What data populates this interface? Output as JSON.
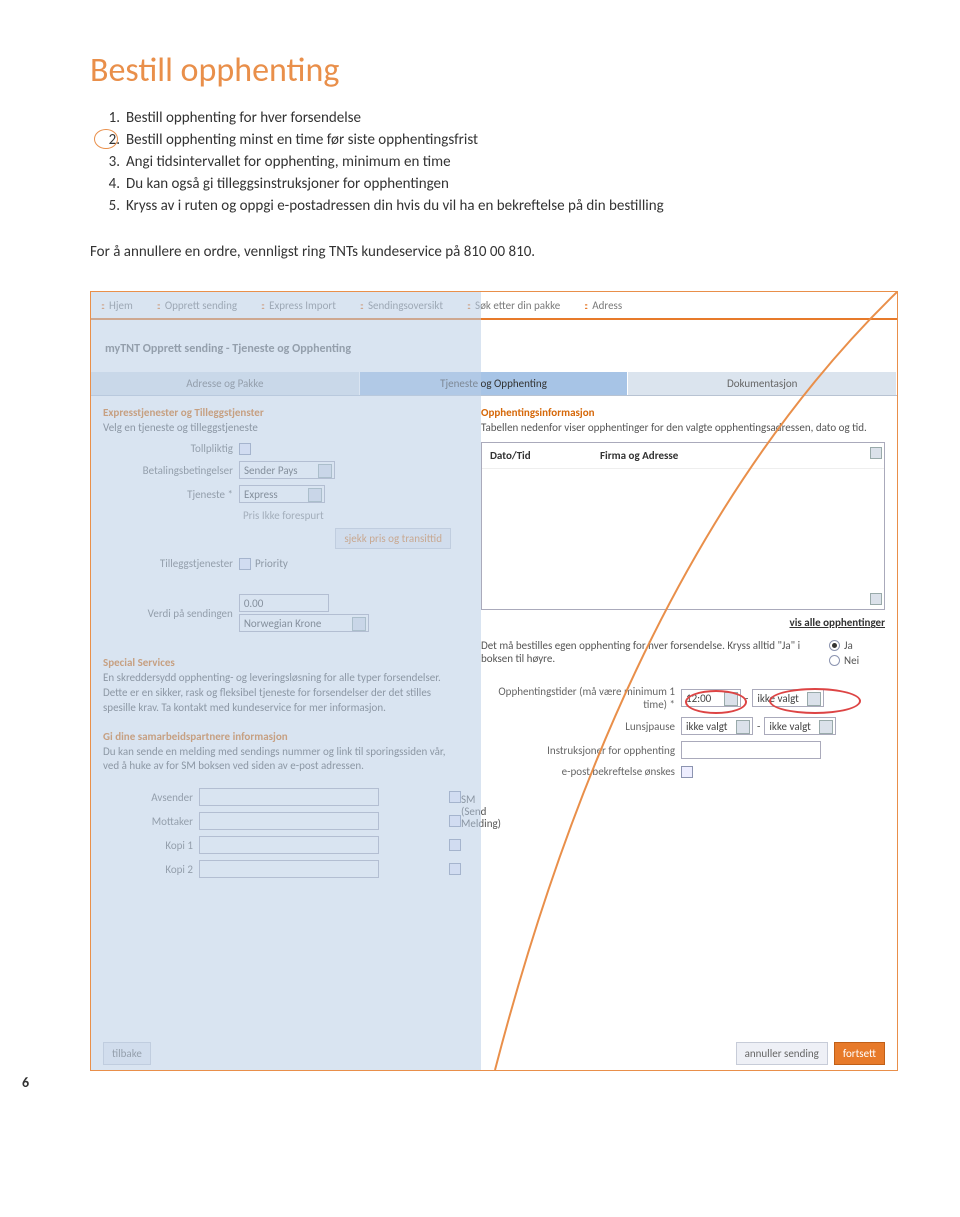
{
  "page_number": "6",
  "title": "Bestill opphenting",
  "steps": [
    "Bestill opphenting for hver forsendelse",
    "Bestill opphenting minst en time før siste opphentingsfrist",
    "Angi tidsintervallet for opphenting, minimum en time",
    "Du kan også gi tilleggsinstruksjoner for opphentingen",
    "Kryss av i ruten og oppgi e-postadressen din hvis du vil ha en bekreftelse på din bestilling"
  ],
  "note": "For å annullere en ordre, vennligst ring TNTs kundeservice på 810 00 810.",
  "nav": {
    "items": [
      "Hjem",
      "Opprett sending",
      "Express Import",
      "Sendingsoversikt",
      "Søk etter din pakke",
      "Adress"
    ]
  },
  "section_title": "myTNT Opprett sending - Tjeneste og Opphenting",
  "tabs": [
    "Adresse og Pakke",
    "Tjeneste og Opphenting",
    "Dokumentasjon"
  ],
  "left_panel": {
    "grp1_head": "Expresstjenester og Tilleggstjenster",
    "grp1_sub": "Velg en tjeneste og tilleggstjeneste",
    "toll_label": "Tollpliktig",
    "pay_label": "Betalingsbetingelser",
    "pay_value": "Sender Pays",
    "service_label": "Tjeneste *",
    "service_value": "Express",
    "price_note": "Pris Ikke forespurt",
    "check_btn": "sjekk pris og transittid",
    "addons_label": "Tilleggstjenester",
    "addons_opt": "Priority",
    "value_label": "Verdi på sendingen",
    "value_amount": "0.00",
    "value_currency": "Norwegian Krone",
    "spc_head": "Special Services",
    "spc_text": "En skreddersydd opphenting- og leveringsløsning for alle typer forsendelser. Dette er en sikker, rask og fleksibel tjeneste for forsendelser der det stilles spesille krav. Ta kontakt med kundeservice for mer informasjon.",
    "info_head": "Gi dine samarbeidspartnere informasjon",
    "info_text": "Du kan sende en melding med sendings nummer og link til sporingssiden vår, ved å huke av for SM boksen ved siden av e-post adressen.",
    "sm_label": "SM\n(Send\nMelding)",
    "avsender": "Avsender",
    "mottaker": "Mottaker",
    "kopi1": "Kopi 1",
    "kopi2": "Kopi 2"
  },
  "right_panel": {
    "head": "Opphentingsinformasjon",
    "sub": "Tabellen nedenfor viser opphentinger for den valgte opphentingsadressen, dato og tid.",
    "th1": "Dato/Tid",
    "th2": "Firma og Adresse",
    "vis_link": "vis alle opphentinger",
    "radio_text": "Det må bestilles egen opphenting for hver forsendelse. Kryss alltid \"Ja\" i boksen til høyre.",
    "yes": "Ja",
    "no": "Nei",
    "time_label": "Opphentingstider (må være minimum 1 time) *",
    "time_from": "12:00",
    "time_to": "ikke valgt",
    "lunch_label": "Lunsjpause",
    "lunch_from": "ikke valgt",
    "lunch_to": "ikke valgt",
    "instr_label": "Instruksjoner for opphenting",
    "email_label": "e-post bekreftelse ønskes"
  },
  "bottom": {
    "back": "tilbake",
    "cancel": "annuller sending",
    "next": "fortsett"
  }
}
